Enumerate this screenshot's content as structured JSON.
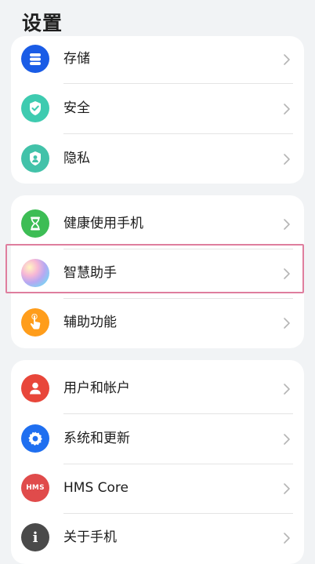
{
  "header": {
    "title": "设置"
  },
  "colors": {
    "storage": "#1a5ce6",
    "security": "#3ecbb0",
    "privacy": "#42c2a9",
    "health": "#3dbd55",
    "accessibility": "#ff9d1b",
    "account": "#e8463a",
    "system": "#1f6ff0",
    "hms": "#e04b4b",
    "about": "#4a4a4a",
    "highlight": "#df7e9e"
  },
  "group1": [
    {
      "label": "存储",
      "icon": "storage-icon"
    },
    {
      "label": "安全",
      "icon": "shield-check-icon"
    },
    {
      "label": "隐私",
      "icon": "privacy-shield-icon"
    }
  ],
  "group2": [
    {
      "label": "健康使用手机",
      "icon": "hourglass-icon"
    },
    {
      "label": "智慧助手",
      "icon": "smart-assistant-orb-icon"
    },
    {
      "label": "辅助功能",
      "icon": "hand-touch-icon"
    }
  ],
  "group3": [
    {
      "label": "用户和帐户",
      "icon": "user-icon"
    },
    {
      "label": "系统和更新",
      "icon": "gear-icon"
    },
    {
      "label": "HMS Core",
      "icon": "hms-icon",
      "icon_text": "HMS"
    },
    {
      "label": "关于手机",
      "icon": "info-icon",
      "icon_text": "i"
    }
  ]
}
